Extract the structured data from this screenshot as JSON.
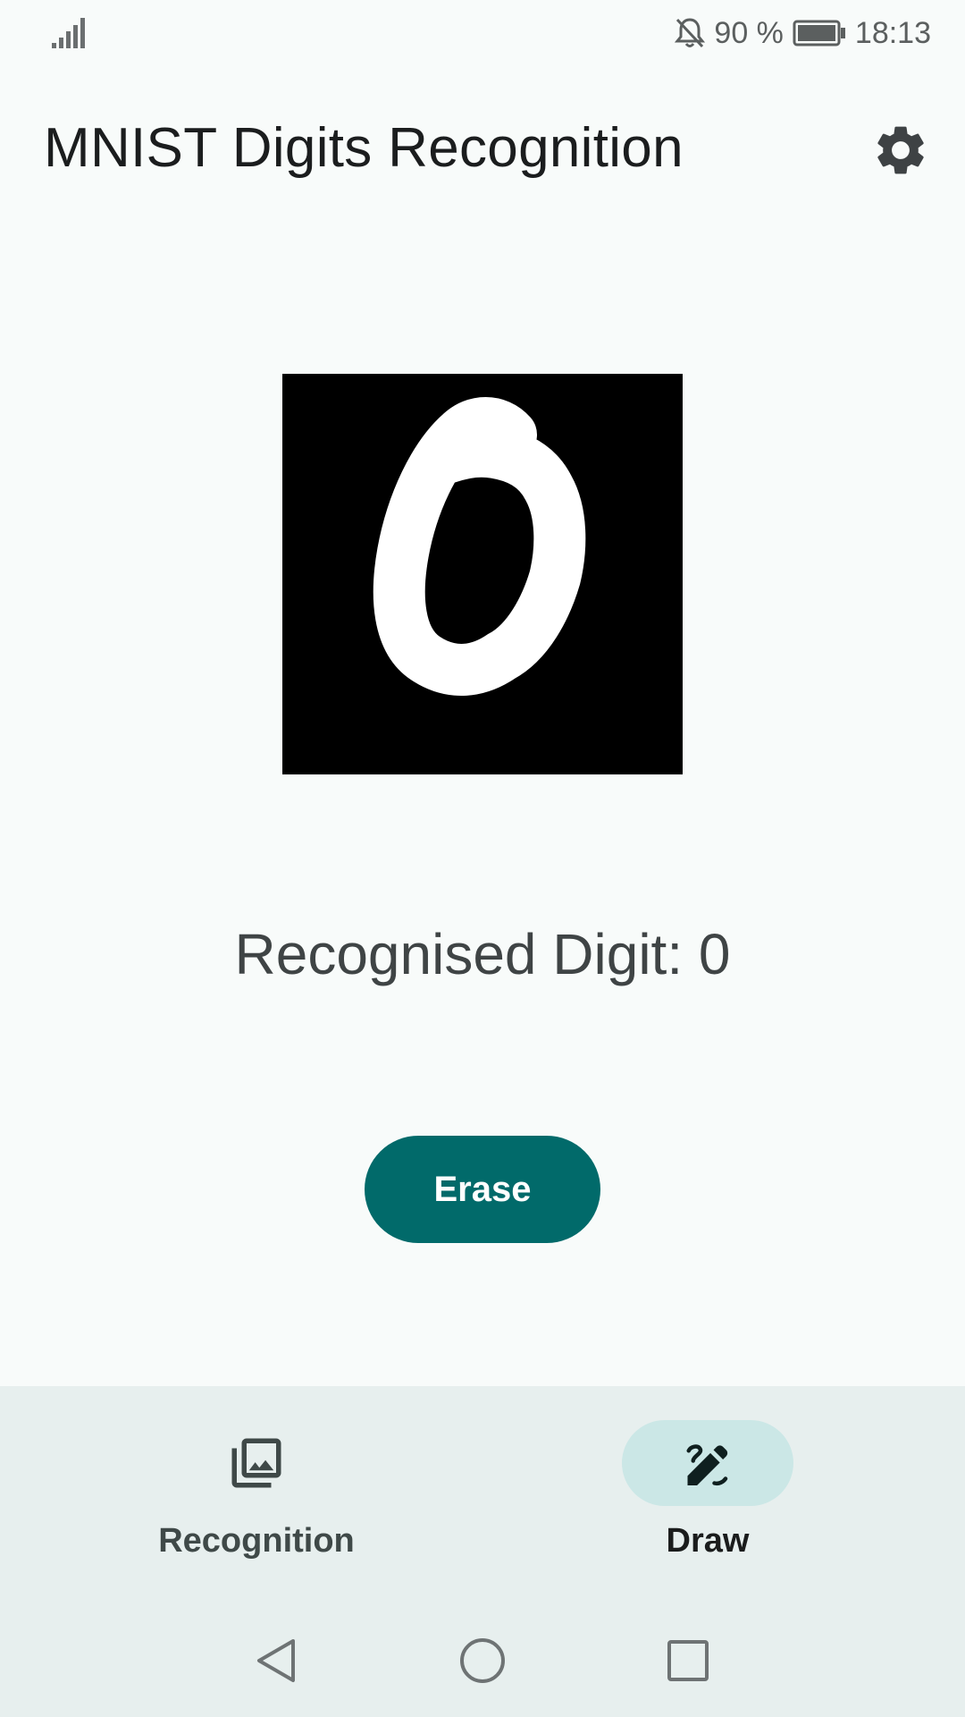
{
  "status_bar": {
    "battery_percent": "90 %",
    "time": "18:13",
    "icons": [
      "signal-icon",
      "bell-off-icon",
      "battery-icon"
    ]
  },
  "app_bar": {
    "title": "MNIST Digits Recognition",
    "settings_icon": "gear-icon"
  },
  "drawing": {
    "canvas_background": "#000000",
    "stroke_color": "#ffffff"
  },
  "result": {
    "text": "Recognised Digit: 0"
  },
  "actions": {
    "erase_label": "Erase"
  },
  "bottom_nav": {
    "items": [
      {
        "label": "Recognition",
        "icon": "photo-library-icon",
        "active": false
      },
      {
        "label": "Draw",
        "icon": "draw-icon",
        "active": true
      }
    ]
  },
  "system_nav": {
    "buttons": [
      "back-icon",
      "home-icon",
      "recents-icon"
    ]
  },
  "colors": {
    "primary": "#016a6a",
    "nav_indicator": "#cbe7e6",
    "background": "#f8fbfa",
    "nav_background": "#e7efee"
  }
}
